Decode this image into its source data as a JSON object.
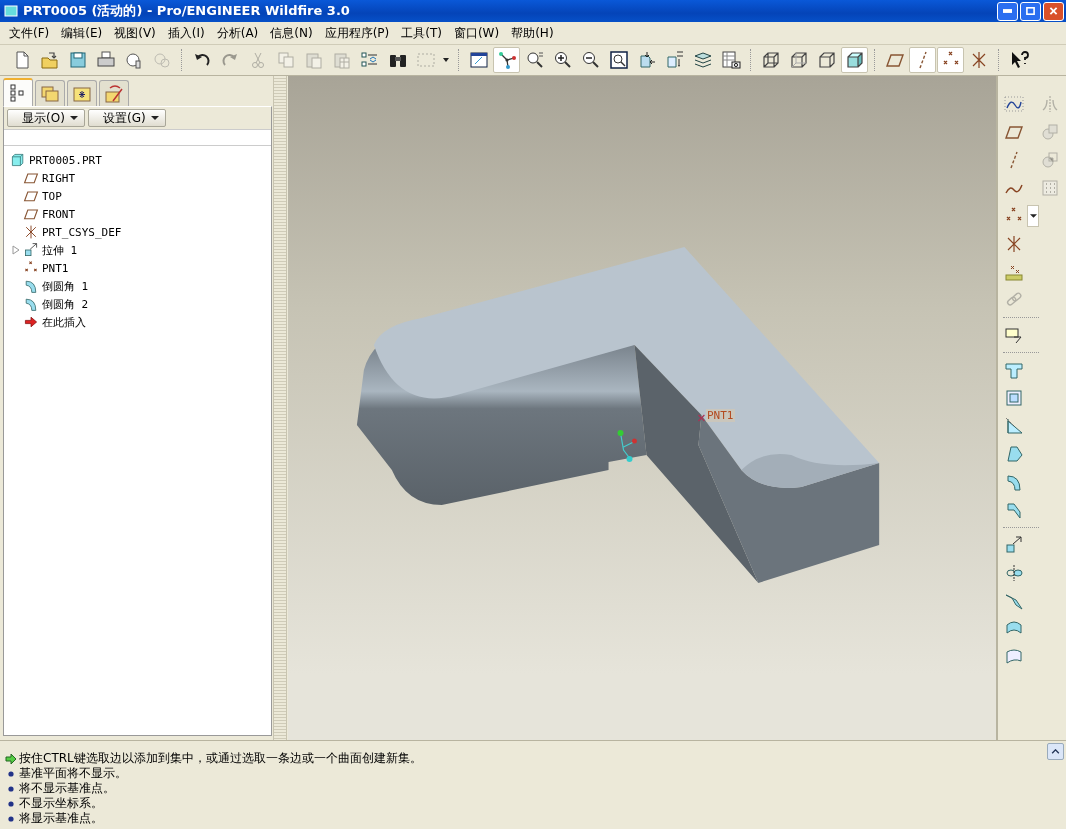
{
  "window": {
    "title": "PRT0005 (活动的) - Pro/ENGINEER Wildfire 3.0"
  },
  "menu": [
    "文件(F)",
    "编辑(E)",
    "视图(V)",
    "插入(I)",
    "分析(A)",
    "信息(N)",
    "应用程序(P)",
    "工具(T)",
    "窗口(W)",
    "帮助(H)"
  ],
  "toolbar": {
    "groups": [
      [
        {
          "pressed": false,
          "disabled": false
        },
        {
          "pressed": false,
          "disabled": false
        },
        {
          "pressed": false,
          "disabled": false
        },
        {
          "pressed": false,
          "disabled": false
        },
        {
          "pressed": false,
          "disabled": false
        },
        {
          "pressed": false,
          "disabled": true
        }
      ],
      [
        {
          "pressed": false,
          "disabled": false
        },
        {
          "pressed": false,
          "disabled": true
        },
        {
          "pressed": false,
          "disabled": true
        },
        {
          "pressed": false,
          "disabled": true
        },
        {
          "pressed": false,
          "disabled": true
        },
        {
          "pressed": false,
          "disabled": true
        },
        {
          "pressed": false,
          "disabled": false
        },
        {
          "pressed": false,
          "disabled": false
        },
        {
          "pressed": false,
          "disabled": true
        },
        {
          "pressed": false,
          "disabled": false
        }
      ],
      [
        {
          "pressed": false,
          "disabled": false
        },
        {
          "pressed": true,
          "disabled": false
        },
        {
          "pressed": false,
          "disabled": false
        },
        {
          "pressed": false,
          "disabled": false
        },
        {
          "pressed": false,
          "disabled": false
        },
        {
          "pressed": false,
          "disabled": false
        },
        {
          "pressed": false,
          "disabled": false
        },
        {
          "pressed": false,
          "disabled": false
        },
        {
          "pressed": false,
          "disabled": false
        },
        {
          "pressed": false,
          "disabled": false
        }
      ],
      [
        {
          "pressed": false,
          "disabled": false
        },
        {
          "pressed": false,
          "disabled": false
        },
        {
          "pressed": false,
          "disabled": false
        },
        {
          "pressed": true,
          "disabled": false
        }
      ],
      [
        {
          "pressed": false,
          "disabled": false
        },
        {
          "pressed": true,
          "disabled": false
        },
        {
          "pressed": true,
          "disabled": false
        },
        {
          "pressed": false,
          "disabled": false
        }
      ],
      [
        {
          "pressed": false,
          "disabled": false
        }
      ]
    ]
  },
  "model_tree": {
    "tabs": [
      {
        "selected": true
      },
      {
        "selected": false
      },
      {
        "selected": false
      },
      {
        "selected": false
      }
    ],
    "buttons": [
      "显示(O)",
      "设置(G)"
    ],
    "root": {
      "label": "PRT0005.PRT",
      "kind": "part",
      "children": [
        {
          "label": "RIGHT",
          "kind": "plane"
        },
        {
          "label": "TOP",
          "kind": "plane"
        },
        {
          "label": "FRONT",
          "kind": "plane"
        },
        {
          "label": "PRT_CSYS_DEF",
          "kind": "csys"
        },
        {
          "label": "拉伸 1",
          "kind": "extrude",
          "expanded": false
        },
        {
          "label": "PNT1",
          "kind": "point"
        },
        {
          "label": "倒圆角 1",
          "kind": "round"
        },
        {
          "label": "倒圆角 2",
          "kind": "round"
        },
        {
          "label": "在此插入",
          "kind": "insert"
        }
      ]
    }
  },
  "viewport": {
    "point_label": "PNT1"
  },
  "feature_toolbar": {
    "columns": [
      {
        "groups": [
          [
            {
              "disabled": false,
              "has_menu": false
            },
            {
              "disabled": false,
              "has_menu": false
            },
            {
              "disabled": false,
              "has_menu": false
            },
            {
              "disabled": false,
              "has_menu": false
            },
            {
              "disabled": false,
              "has_menu": true
            },
            {
              "disabled": false,
              "has_menu": false
            },
            {
              "disabled": false,
              "has_menu": false
            },
            {
              "disabled": true,
              "has_menu": false
            }
          ],
          [
            {
              "disabled": false,
              "has_menu": false
            }
          ],
          [
            {
              "disabled": false,
              "has_menu": false
            },
            {
              "disabled": false,
              "has_menu": false
            },
            {
              "disabled": false,
              "has_menu": false
            },
            {
              "disabled": false,
              "has_menu": false
            },
            {
              "disabled": false,
              "has_menu": false
            },
            {
              "disabled": false,
              "has_menu": false
            }
          ],
          [
            {
              "disabled": false,
              "has_menu": false
            },
            {
              "disabled": false,
              "has_menu": false
            },
            {
              "disabled": false,
              "has_menu": false
            },
            {
              "disabled": false,
              "has_menu": false
            },
            {
              "disabled": false,
              "has_menu": false
            }
          ]
        ]
      },
      {
        "groups": [
          [
            {
              "disabled": true,
              "has_menu": false
            },
            {
              "disabled": true,
              "has_menu": false
            },
            {
              "disabled": true,
              "has_menu": false
            },
            {
              "disabled": true,
              "has_menu": false
            }
          ]
        ]
      }
    ]
  },
  "messages": [
    {
      "kind": "prompt",
      "text": "按住CTRL键选取边以添加到集中，或通过选取一条边或一个曲面创建新集。"
    },
    {
      "kind": "info",
      "text": "基准平面将不显示。"
    },
    {
      "kind": "info",
      "text": "将不显示基准点。"
    },
    {
      "kind": "info",
      "text": "不显示坐标系。"
    },
    {
      "kind": "info",
      "text": "将显示基准点。"
    }
  ]
}
